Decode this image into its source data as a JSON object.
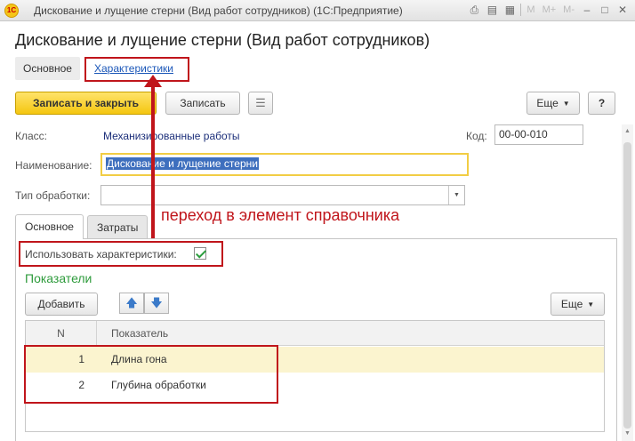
{
  "window": {
    "title": "Дискование и лущение стерни (Вид работ сотрудников)  (1С:Предприятие)",
    "logo_text": "1С",
    "icons": [
      "print-icon",
      "save-icon",
      "calendar-icon"
    ],
    "m_labels": [
      "M",
      "M+",
      "M-"
    ],
    "controls": [
      "minimize-icon",
      "maximize-icon",
      "close-icon"
    ]
  },
  "form": {
    "title": "Дискование и лущение стерни (Вид работ сотрудников)",
    "nav": [
      "Основное",
      "Характеристики"
    ]
  },
  "toolbar": {
    "save_close": "Записать и закрыть",
    "save": "Записать",
    "more": "Еще",
    "help": "?"
  },
  "fields": {
    "class_label": "Класс:",
    "class_value": "Механизированные работы",
    "code_label": "Код:",
    "code_value": "00-00-010",
    "name_label": "Наименование:",
    "name_value": "Дискование и лущение стерни",
    "type_label": "Тип обработки:",
    "type_value": ""
  },
  "tabs": [
    "Основное",
    "Затраты"
  ],
  "annotation": "переход в элемент справочника",
  "panel": {
    "use_chars_label": "Использовать характеристики:",
    "use_chars_checked": true,
    "section_title": "Показатели",
    "add_button": "Добавить",
    "more": "Еще"
  },
  "table": {
    "columns": [
      "N",
      "Показатель"
    ],
    "rows": [
      {
        "n": "1",
        "name": "Длина гона",
        "selected": true
      },
      {
        "n": "2",
        "name": "Глубина обработки",
        "selected": false
      }
    ]
  },
  "colors": {
    "accent_yellow": "#f4c610",
    "annotation_red": "#c0151b",
    "section_green": "#2e9b3c",
    "link_blue": "#1a56b8"
  }
}
